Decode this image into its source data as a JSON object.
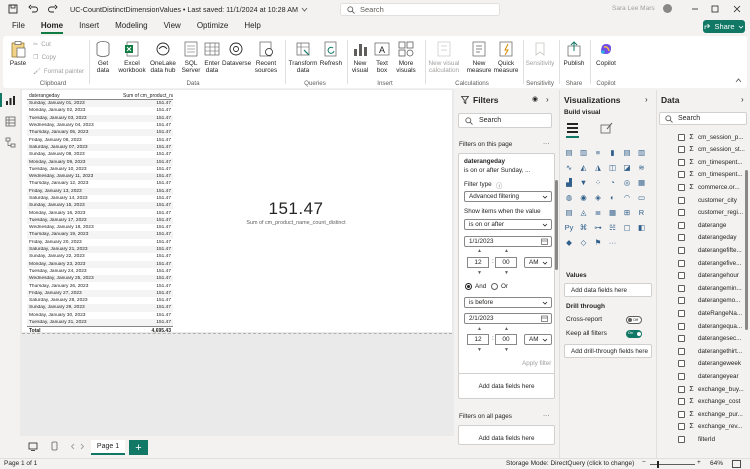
{
  "window": {
    "doc_title": "UC-CountDistinctDimensionValues • Last saved: 11/1/2024 at 10:28 AM",
    "search_placeholder": "Search",
    "user_name": "Sara Lee Mars"
  },
  "tabs": [
    "File",
    "Home",
    "Insert",
    "Modeling",
    "View",
    "Optimize",
    "Help"
  ],
  "share_label": "Share",
  "ribbon": {
    "paste": "Paste",
    "cut": "Cut",
    "copy": "Copy",
    "format_painter": "Format painter",
    "get_data": "Get data",
    "excel_workbook": "Excel workbook",
    "onelake": "OneLake data hub",
    "sql_server": "SQL Server",
    "enter_data": "Enter data",
    "dataverse": "Dataverse",
    "recent_sources": "Recent sources",
    "transform_data": "Transform data",
    "refresh": "Refresh",
    "new_visual": "New visual",
    "text_box": "Text box",
    "more_visuals": "More visuals",
    "new_visual_calc": "New visual calculation",
    "new_measure": "New measure",
    "quick_measure": "Quick measure",
    "sensitivity": "Sensitivity",
    "publish": "Publish",
    "copilot": "Copilot",
    "groups": {
      "clipboard": "Clipboard",
      "data": "Data",
      "queries": "Queries",
      "insert": "Insert",
      "calculations": "Calculations",
      "sensitivity": "Sensitivity",
      "share": "Share",
      "copilot": "Copilot"
    }
  },
  "table_visual": {
    "headers": [
      "daterangeday",
      "Sum of cm_product_name_count_distinct"
    ],
    "rows": [
      [
        "Sunday, January 01, 2023",
        "151.47"
      ],
      [
        "Monday, January 02, 2023",
        "151.47"
      ],
      [
        "Tuesday, January 03, 2023",
        "151.47"
      ],
      [
        "Wednesday, January 04, 2023",
        "151.47"
      ],
      [
        "Thursday, January 05, 2023",
        "151.47"
      ],
      [
        "Friday, January 06, 2023",
        "151.47"
      ],
      [
        "Saturday, January 07, 2023",
        "151.47"
      ],
      [
        "Sunday, January 08, 2023",
        "151.47"
      ],
      [
        "Monday, January 09, 2023",
        "151.47"
      ],
      [
        "Tuesday, January 10, 2023",
        "151.47"
      ],
      [
        "Wednesday, January 11, 2023",
        "151.47"
      ],
      [
        "Thursday, January 12, 2023",
        "151.47"
      ],
      [
        "Friday, January 13, 2023",
        "151.47"
      ],
      [
        "Saturday, January 14, 2023",
        "151.47"
      ],
      [
        "Sunday, January 15, 2023",
        "151.47"
      ],
      [
        "Monday, January 16, 2023",
        "151.47"
      ],
      [
        "Tuesday, January 17, 2023",
        "151.47"
      ],
      [
        "Wednesday, January 18, 2023",
        "151.47"
      ],
      [
        "Thursday, January 19, 2023",
        "151.47"
      ],
      [
        "Friday, January 20, 2023",
        "151.47"
      ],
      [
        "Saturday, January 21, 2023",
        "151.47"
      ],
      [
        "Sunday, January 22, 2023",
        "151.47"
      ],
      [
        "Monday, January 23, 2023",
        "151.47"
      ],
      [
        "Tuesday, January 24, 2023",
        "151.47"
      ],
      [
        "Wednesday, January 25, 2023",
        "151.47"
      ],
      [
        "Thursday, January 26, 2023",
        "151.47"
      ],
      [
        "Friday, January 27, 2023",
        "151.47"
      ],
      [
        "Saturday, January 28, 2023",
        "151.47"
      ],
      [
        "Sunday, January 29, 2023",
        "151.47"
      ],
      [
        "Monday, January 30, 2023",
        "151.47"
      ],
      [
        "Tuesday, January 31, 2023",
        "151.47"
      ]
    ],
    "total_label": "Total",
    "total_value": "4,695.43"
  },
  "card": {
    "value": "151.47",
    "label": "Sum of cm_product_name_count_distinct"
  },
  "page_tab": "Page 1",
  "status": {
    "page_info": "Page 1 of 1",
    "storage_mode": "Storage Mode: DirectQuery (click to change)",
    "zoom": "64%"
  },
  "filters": {
    "title": "Filters",
    "search_placeholder": "Search",
    "on_this_page": "Filters on this page",
    "field_name": "daterangeday",
    "field_summary": "is on or after Sunday, ...",
    "filter_type_label": "Filter type",
    "filter_type_value": "Advanced filtering",
    "show_items_label": "Show items when the value",
    "cond1": "is on or after",
    "date1": "1/1/2023",
    "hour1": "12",
    "min1": "00",
    "ampm1": "AM",
    "and_label": "And",
    "or_label": "Or",
    "cond2": "is before",
    "date2": "2/1/2023",
    "hour2": "12",
    "min2": "00",
    "ampm2": "AM",
    "apply_filter": "Apply filter",
    "add_data_fields": "Add data fields here",
    "on_all_pages": "Filters on all pages",
    "add_data_fields_all": "Add data fields here"
  },
  "visualizations": {
    "title": "Visualizations",
    "build_visual": "Build visual",
    "values_label": "Values",
    "values_well": "Add data fields here",
    "drill_through": "Drill through",
    "cross_report": "Cross-report",
    "cross_report_state": "Off",
    "keep_all_filters": "Keep all filters",
    "keep_all_filters_state": "On",
    "drill_well": "Add drill-through fields here"
  },
  "data_pane": {
    "title": "Data",
    "search_placeholder": "Search",
    "fields": [
      {
        "name": "cm_session_p...",
        "sigma": true
      },
      {
        "name": "cm_session_st...",
        "sigma": true
      },
      {
        "name": "cm_timespent...",
        "sigma": true
      },
      {
        "name": "cm_timespent...",
        "sigma": true
      },
      {
        "name": "commerce.or...",
        "sigma": true
      },
      {
        "name": "customer_city",
        "sigma": false
      },
      {
        "name": "customer_regi...",
        "sigma": false
      },
      {
        "name": "daterange",
        "sigma": false
      },
      {
        "name": "daterangeday",
        "sigma": false
      },
      {
        "name": "daterangefifte...",
        "sigma": false
      },
      {
        "name": "daterangefive...",
        "sigma": false
      },
      {
        "name": "daterangehour",
        "sigma": false
      },
      {
        "name": "daterangemin...",
        "sigma": false
      },
      {
        "name": "daterangemo...",
        "sigma": false
      },
      {
        "name": "dateRangeNa...",
        "sigma": false
      },
      {
        "name": "daterangequa...",
        "sigma": false
      },
      {
        "name": "daterangesec...",
        "sigma": false
      },
      {
        "name": "daterangethirt...",
        "sigma": false
      },
      {
        "name": "daterangeweek",
        "sigma": false
      },
      {
        "name": "daterangeyear",
        "sigma": false
      },
      {
        "name": "exchange_buy...",
        "sigma": true
      },
      {
        "name": "exchange_cost",
        "sigma": true
      },
      {
        "name": "exchange_pur...",
        "sigma": true
      },
      {
        "name": "exchange_rev...",
        "sigma": true
      },
      {
        "name": "filterId",
        "sigma": false
      }
    ]
  }
}
